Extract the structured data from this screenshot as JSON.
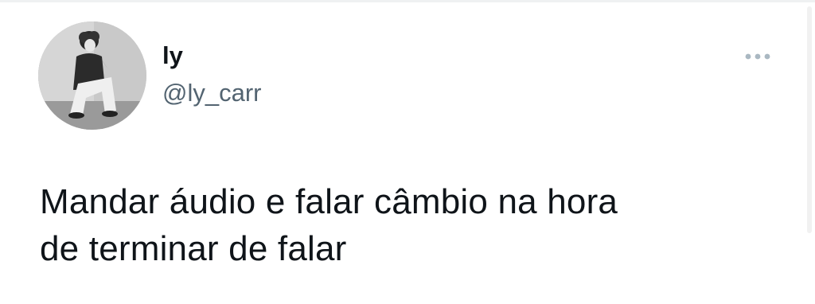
{
  "tweet": {
    "author": {
      "display_name": "ly",
      "handle": "@ly_carr"
    },
    "text_line1": "Mandar áudio e falar câmbio na hora",
    "text_line2": "de terminar de falar",
    "more_icon": "more-horizontal-icon"
  },
  "colors": {
    "text": "#0f1419",
    "secondary_text": "#536471",
    "icon": "#aab8c2"
  }
}
